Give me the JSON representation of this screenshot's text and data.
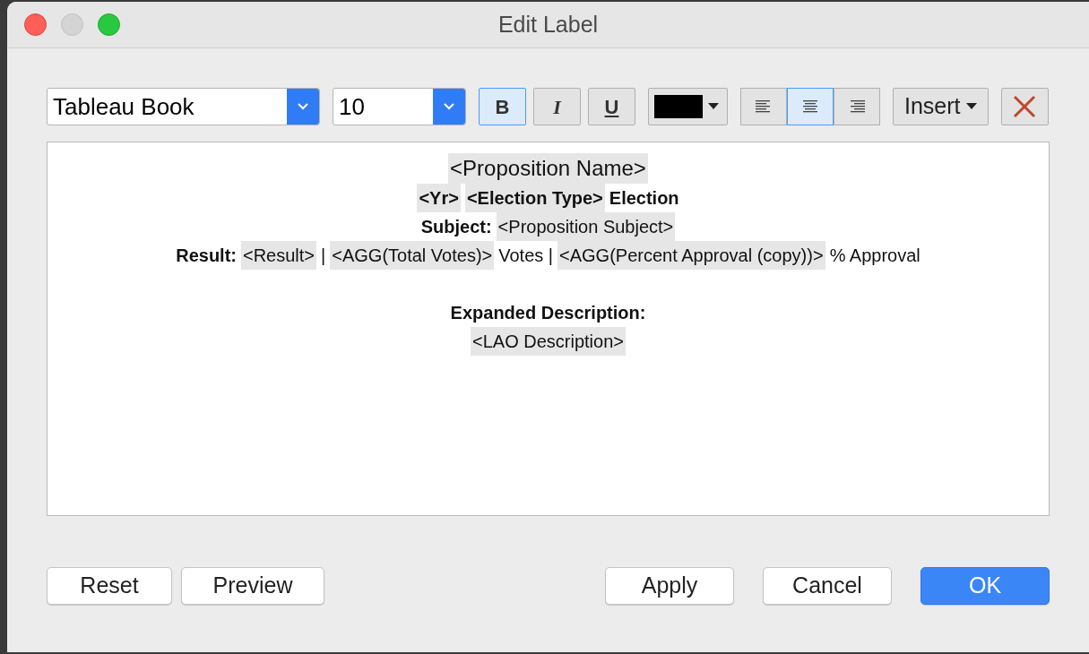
{
  "window": {
    "title": "Edit Label"
  },
  "toolbar": {
    "font": "Tableau Book",
    "size": "10",
    "styles": [
      {
        "kind": "bold",
        "label": "B",
        "selected": true
      },
      {
        "kind": "italic",
        "label": "I",
        "selected": false
      },
      {
        "kind": "underline",
        "label": "U",
        "selected": false
      }
    ],
    "color_picker": {
      "color": "#000000"
    },
    "alignments": [
      {
        "kind": "left",
        "selected": false
      },
      {
        "kind": "center",
        "selected": true
      },
      {
        "kind": "right",
        "selected": false
      }
    ],
    "insert": "Insert"
  },
  "editor": {
    "lines": [
      {
        "kind": "title",
        "segments": [
          {
            "text": "<Proposition Name>",
            "field": true,
            "bold": false
          }
        ]
      },
      {
        "kind": "line",
        "segments": [
          {
            "text": "<Yr>",
            "field": true,
            "bold": true
          },
          {
            "text": "<Election Type>",
            "field": true,
            "bold": true
          },
          {
            "text": "Election",
            "field": false,
            "bold": true
          }
        ]
      },
      {
        "kind": "line",
        "segments": [
          {
            "text": "Subject:",
            "field": false,
            "bold": true
          },
          {
            "text": "<Proposition Subject>",
            "field": true,
            "bold": false
          }
        ]
      },
      {
        "kind": "line",
        "segments": [
          {
            "text": "Result:",
            "field": false,
            "bold": true
          },
          {
            "text": "<Result>",
            "field": true,
            "bold": false
          },
          {
            "text": "|",
            "field": false,
            "bold": false
          },
          {
            "text": "<AGG(Total Votes)>",
            "field": true,
            "bold": false
          },
          {
            "text": "Votes |",
            "field": false,
            "bold": false
          },
          {
            "text": "<AGG(Percent Approval (copy))>",
            "field": true,
            "bold": false
          },
          {
            "text": "% Approval",
            "field": false,
            "bold": false
          }
        ]
      },
      {
        "kind": "blank"
      },
      {
        "kind": "line",
        "segments": [
          {
            "text": "Expanded Description:",
            "field": false,
            "bold": true
          }
        ]
      },
      {
        "kind": "line",
        "segments": [
          {
            "text": "<LAO Description>",
            "field": true,
            "bold": false
          }
        ]
      }
    ]
  },
  "buttons_left": [
    {
      "label": "Reset",
      "primary": false
    },
    {
      "label": "Preview",
      "primary": false
    }
  ],
  "buttons_right": [
    {
      "label": "Apply",
      "primary": false
    },
    {
      "label": "Cancel",
      "primary": false
    },
    {
      "label": "OK",
      "primary": true
    }
  ]
}
